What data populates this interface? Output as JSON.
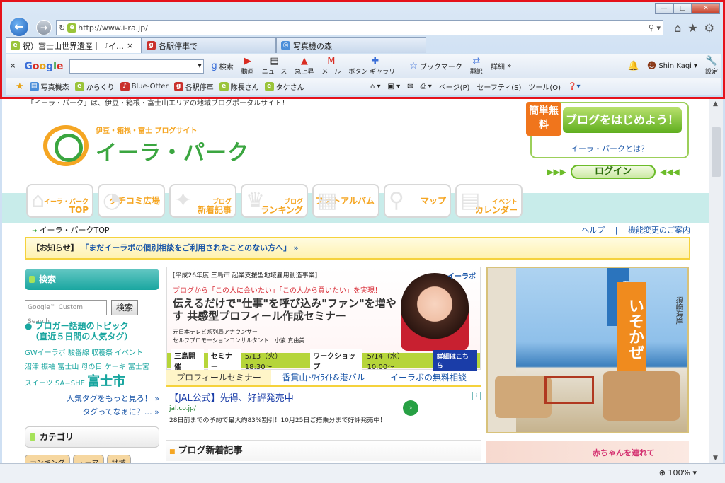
{
  "browser": {
    "url": "http://www.i-ra.jp/",
    "tabs": [
      {
        "title": "祝）富士山世界遺産｜『イ…",
        "active": true
      },
      {
        "title": "各駅停車で",
        "active": false
      },
      {
        "title": "写真機の森",
        "active": false
      }
    ],
    "window_controls": {
      "min": "—",
      "max": "□",
      "close": "✕"
    }
  },
  "google_toolbar": {
    "logo": "Google",
    "search_btn": "検索",
    "items": [
      "動画",
      "ニュース",
      "急上昇",
      "メール",
      "ボタン",
      "ギャラリー",
      "ブックマーク",
      "翻訳",
      "詳細"
    ],
    "user": "Shin Kagi",
    "settings": "設定",
    "more": "»"
  },
  "favorites_bar": {
    "items": [
      "写真機森",
      "からくり",
      "Blue-Otter",
      "各駅停車",
      "隊長さん",
      "タケさん"
    ],
    "commands": [
      "ページ(P)",
      "セーフティ(S)",
      "ツール(O)"
    ]
  },
  "page": {
    "intro": "「イーラ・パーク」は、伊豆・箱根・富士山エリアの地域ブログポータルサイト！",
    "logo_sub": "伊豆・箱根・富士 ブログサイト",
    "logo_title": "イーラ・パーク",
    "badge": "簡単無料",
    "start_blog": "ブログをはじめよう！",
    "what_is": "イーラ・パークとは？",
    "login": "ログイン",
    "nav": [
      {
        "t1": "イーラ・パーク",
        "t2": "TOP"
      },
      {
        "t1": "",
        "t2": "クチコミ広場"
      },
      {
        "t1": "ブログ",
        "t2": "新着記事"
      },
      {
        "t1": "ブログ",
        "t2": "ランキング"
      },
      {
        "t1": "",
        "t2": "フォトアルバム"
      },
      {
        "t1": "",
        "t2": "マップ"
      },
      {
        "t1": "イベント",
        "t2": "カレンダー"
      }
    ],
    "breadcrumb": "イーラ・パークTOP",
    "help": "ヘルプ",
    "device_change": "機能変更のご案内",
    "notice_label": "【お知らせ】",
    "notice_text": "「まだイーラボの個別相談をご利用されたことのない方へ」",
    "notice_arrow": "»",
    "sidebar": {
      "search_head": "検索",
      "search_placeholder": "Google™ Custom Search",
      "search_btn": "検索",
      "topic": "ブロガー話題のトピック",
      "topic_sub": "（直近５日間の人気タグ）",
      "tags_line1": "GWイーラボ 駿番線 収穫祭 イベント",
      "tags_line2": "沼津 振袖 富士山 母の日 ケーキ 富士宮",
      "tags_line3": "スイーツ SA−SHE",
      "tag_big": "富士市",
      "more_tags": "人気タグをもっと見る！ »",
      "what_tags": "タグってなぁに？… »",
      "category_head": "カテゴリ",
      "category_tabs": [
        "ランキング",
        "テーマ",
        "地域"
      ]
    },
    "banner": {
      "h1": "[平成26年度 三島市 起業支援型地域雇用創造事業]",
      "h2": "ブログから「この人に会いたい」「この人から買いたい」を実現！",
      "h3": "伝えるだけで\"仕事\"を呼び込み\"ファン\"を増やす 共感型プロフィール作成セミナー",
      "h4a": "元日本テレビ系列局アナウンサー",
      "h4b": "セルフプロモーションコンサルタント　小紫 真由美",
      "logo": "イーラボ",
      "venue": "三島開催",
      "lab1": "セミナー",
      "date1": "5/13（火）18:30〜",
      "lab2": "ワークショップ",
      "date2": "5/14（水）10:00〜",
      "details": "詳細はこちら"
    },
    "subtabs": [
      "プロフィールセミナー",
      "香貫山ﾄﾜｲﾗｲﾄ&港バル",
      "イーラボの無料相談"
    ],
    "ad": {
      "title": "【JAL公式】先得、好評発売中",
      "url": "jal.co.jp/",
      "desc": "28日前までの予約で最大約83%割引！10月25日ご搭乗分まで好評発売中！",
      "go": "›",
      "info": "i"
    },
    "new_posts": "ブログ新着記事",
    "hotel": {
      "tag": "海辺のお宿",
      "name": "いそかぜ",
      "sub": "国立公園・伊豆下田",
      "right": "須崎海岸"
    },
    "baby_banner": "赤ちゃんを連れて"
  },
  "status": {
    "zoom": "100%"
  }
}
